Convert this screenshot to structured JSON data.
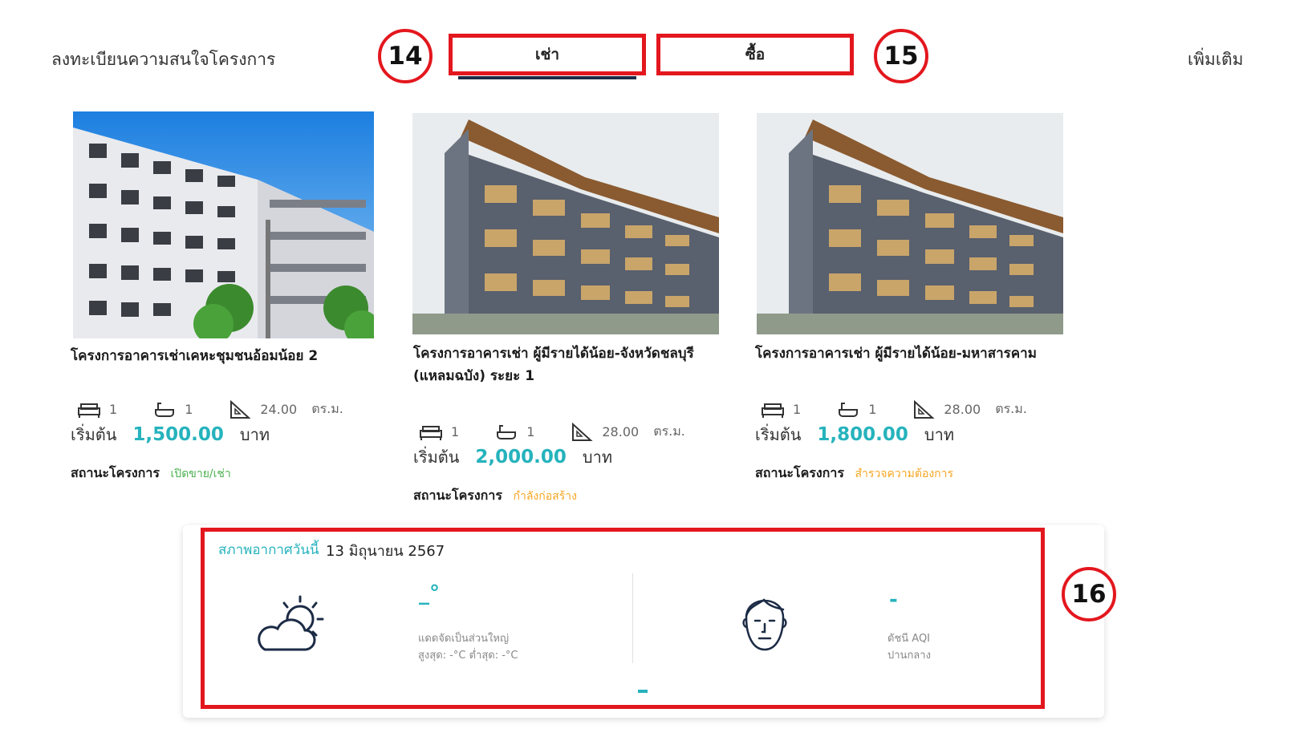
{
  "header": {
    "register_label": "ลงทะเบียนความสนใจโครงการ",
    "more_label": "เพิ่มเติม",
    "tabs": [
      {
        "label": "เช่า",
        "active": true
      },
      {
        "label": "ซื้อ",
        "active": false
      }
    ]
  },
  "annotations": {
    "rent_marker": "14",
    "buy_marker": "15",
    "weather_marker": "16"
  },
  "projects": [
    {
      "title": "โครงการอาคารเช่าเคหะชุมชนอ้อมน้อย 2",
      "bedrooms": "1",
      "bathrooms": "1",
      "area": "24.00",
      "area_unit": "ตร.ม.",
      "price_prefix": "เริ่มต้น",
      "price": "1,500.00",
      "currency": "บาท",
      "status_label": "สถานะโครงการ",
      "status": "เปิดขาย/เช่า"
    },
    {
      "title": "โครงการอาคารเช่า ผู้มีรายได้น้อย-จังหวัดชลบุรี (แหลมฉบัง) ระยะ 1",
      "bedrooms": "1",
      "bathrooms": "1",
      "area": "28.00",
      "area_unit": "ตร.ม.",
      "price_prefix": "เริ่มต้น",
      "price": "2,000.00",
      "currency": "บาท",
      "status_label": "สถานะโครงการ",
      "status": "กำลังก่อสร้าง"
    },
    {
      "title": "โครงการอาคารเช่า ผู้มีรายได้น้อย-มหาสารคาม",
      "bedrooms": "1",
      "bathrooms": "1",
      "area": "28.00",
      "area_unit": "ตร.ม.",
      "price_prefix": "เริ่มต้น",
      "price": "1,800.00",
      "currency": "บาท",
      "status_label": "สถานะโครงการ",
      "status": "สำรวจความต้องการ"
    }
  ],
  "weather": {
    "heading": "สภาพอากาศวันนี้",
    "date": "13 มิถุนายน 2567",
    "temperature": "_°",
    "description": "แดดจัดเป็นส่วนใหญ่",
    "min_max": "สูงสุด: -°C  ต่ำสุด: -°C",
    "aqi_value": "-",
    "aqi_label": "ดัชนี AQI",
    "aqi_level": "ปานกลาง",
    "icon": "partly-cloudy-icon",
    "aqi_icon": "face-icon"
  },
  "colors": {
    "accent": "#26b3bd",
    "highlight": "#e3171e",
    "status_open": "#4cb050",
    "status_other": "#f5a623"
  }
}
